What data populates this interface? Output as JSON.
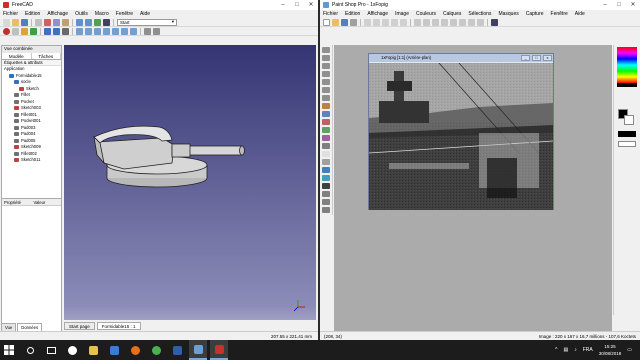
{
  "freecad": {
    "title": "FreeCAD",
    "menu": [
      "Fichier",
      "Edition",
      "Affichage",
      "Outils",
      "Macro",
      "Fenêtre",
      "Aide"
    ],
    "workbench": "Start",
    "combo_header": "Vue combinée",
    "tabs": [
      "Modèle",
      "Tâches"
    ],
    "tree_header": "Étiquettes & attributs",
    "tree_section": "Application",
    "tree": [
      {
        "label": "Formidable15",
        "indent": 1,
        "color": "#2f6fc7"
      },
      {
        "label": "socle",
        "indent": 2,
        "color": "#2f6fc7"
      },
      {
        "label": "Sketch",
        "indent": 3,
        "color": "#c04040"
      },
      {
        "label": "Fillet",
        "indent": 2,
        "color": "#707070"
      },
      {
        "label": "Pocket",
        "indent": 2,
        "color": "#707070"
      },
      {
        "label": "Sketch003",
        "indent": 2,
        "color": "#c04040"
      },
      {
        "label": "Fillet001",
        "indent": 2,
        "color": "#707070"
      },
      {
        "label": "Pocket001",
        "indent": 2,
        "color": "#707070"
      },
      {
        "label": "Pad003",
        "indent": 2,
        "color": "#707070"
      },
      {
        "label": "Pad004",
        "indent": 2,
        "color": "#707070"
      },
      {
        "label": "Pad005",
        "indent": 2,
        "color": "#707070"
      },
      {
        "label": "Sketch009",
        "indent": 2,
        "color": "#c04040"
      },
      {
        "label": "Fillet002",
        "indent": 2,
        "color": "#707070"
      },
      {
        "label": "Sketch011",
        "indent": 2,
        "color": "#c04040"
      }
    ],
    "prop_cols": [
      "Propriété",
      "Valeur"
    ],
    "bottom_tabs": [
      "Vue",
      "Données"
    ],
    "doc_tabs": [
      "Start page",
      "Formidable15 : 1"
    ],
    "status": "207.55 x 221.41 mm"
  },
  "psp": {
    "title": "Paint Shop Pro - 1xFopig",
    "menu": [
      "Fichier",
      "Edition",
      "Affichage",
      "Image",
      "Couleurs",
      "Calques",
      "Sélections",
      "Masques",
      "Capture",
      "Fenêtre",
      "Aide"
    ],
    "image_title": "1xFopig [1:1] (Arrière-plan)",
    "status_left": "(208, 34)",
    "status_right": "Image : 220 x 167 x 16,7 millions - 107,6 Koctets"
  },
  "taskbar": {
    "time": "15:25",
    "date": "30/08/2018",
    "lang": "FRA"
  }
}
